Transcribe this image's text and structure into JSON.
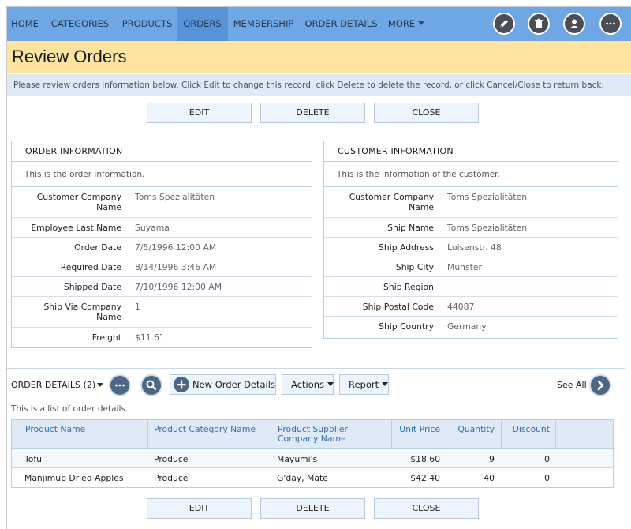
{
  "nav": {
    "items": [
      {
        "label": "Home"
      },
      {
        "label": "Categories"
      },
      {
        "label": "Products"
      },
      {
        "label": "Orders"
      },
      {
        "label": "Membership"
      },
      {
        "label": "Order Details"
      },
      {
        "label": "More"
      }
    ],
    "active_color": "#5793d6",
    "bar_color": "#6fa7e4"
  },
  "page": {
    "title": "Review Orders",
    "description": "Please review orders information below. Click Edit to change this record, click Delete to delete the record, or click Cancel/Close to return back."
  },
  "actions": {
    "edit": "Edit",
    "delete": "Delete",
    "close": "Close"
  },
  "order_info": {
    "title": "Order Information",
    "description": "This is the order information.",
    "fields": [
      {
        "label": "Customer Company Name",
        "value": "Toms Spezialitäten"
      },
      {
        "label": "Employee Last Name",
        "value": "Suyama"
      },
      {
        "label": "Order Date",
        "value": "7/5/1996 12:00 AM"
      },
      {
        "label": "Required Date",
        "value": "8/14/1996 3:46 AM"
      },
      {
        "label": "Shipped Date",
        "value": "7/10/1996 12:00 AM"
      },
      {
        "label": "Ship Via Company Name",
        "value": "1"
      },
      {
        "label": "Freight",
        "value": "$11.61"
      }
    ]
  },
  "customer_info": {
    "title": "Customer Information",
    "description": "This is the information of the customer.",
    "fields": [
      {
        "label": "Customer Company Name",
        "value": "Toms Spezialitäten"
      },
      {
        "label": "Ship Name",
        "value": "Toms Spezialitäten"
      },
      {
        "label": "Ship Address",
        "value": "Luisenstr. 48"
      },
      {
        "label": "Ship City",
        "value": "Münster"
      },
      {
        "label": "Ship Region",
        "value": ""
      },
      {
        "label": "Ship Postal Code",
        "value": "44087"
      },
      {
        "label": "Ship Country",
        "value": "Germany"
      }
    ]
  },
  "order_details": {
    "title": "Order Details (2)",
    "new_label": "New Order Details",
    "actions_label": "Actions",
    "report_label": "Report",
    "see_all": "See All",
    "description": "This is a list of order details.",
    "columns": [
      "Product Name",
      "Product Category Name",
      "Product Supplier Company Name",
      "Unit Price",
      "Quantity",
      "Discount"
    ],
    "rows": [
      [
        "Tofu",
        "Produce",
        "Mayumi's",
        "$18.60",
        "9",
        "0"
      ],
      [
        "Manjimup Dried Apples",
        "Produce",
        "G'day, Mate",
        "$42.40",
        "40",
        "0"
      ]
    ]
  }
}
